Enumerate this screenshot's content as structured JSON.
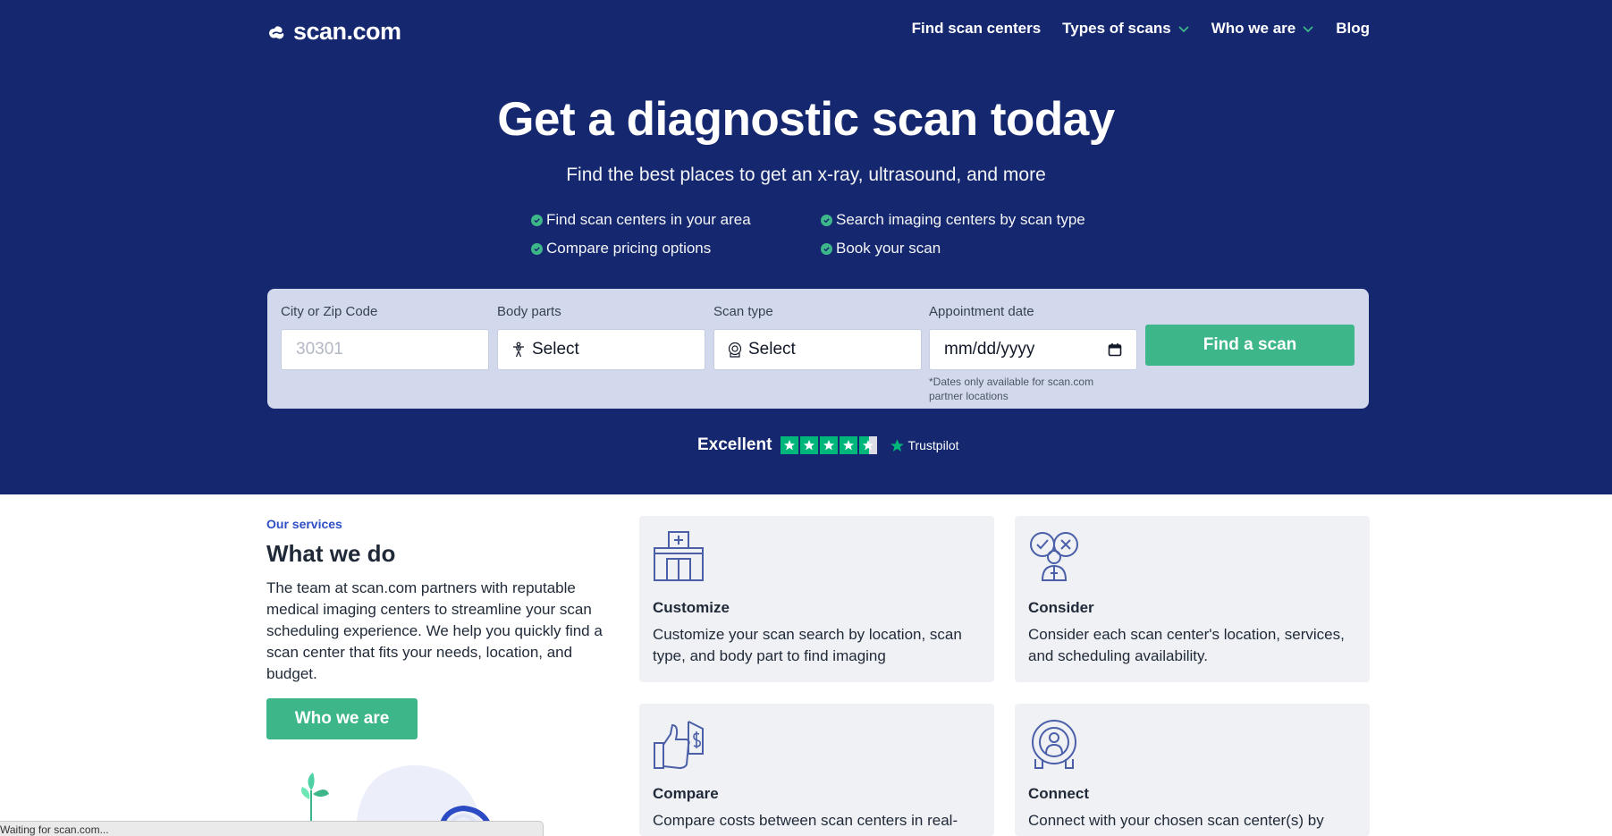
{
  "brand": {
    "logo_text": "scan.com"
  },
  "nav": {
    "links": [
      {
        "label": "Find scan centers",
        "has_dropdown": false
      },
      {
        "label": "Types of scans",
        "has_dropdown": true
      },
      {
        "label": "Who we are",
        "has_dropdown": true
      },
      {
        "label": "Blog",
        "has_dropdown": false
      }
    ]
  },
  "hero": {
    "title": "Get a diagnostic scan today",
    "subtitle": "Find the best places to get an x-ray, ultrasound, and more",
    "features": [
      "Find scan centers in your area",
      "Search imaging centers by scan type",
      "Compare pricing options",
      "Book your scan"
    ]
  },
  "search": {
    "city": {
      "label": "City or Zip Code",
      "placeholder": "30301"
    },
    "body_parts": {
      "label": "Body parts",
      "value": "Select"
    },
    "scan_type": {
      "label": "Scan type",
      "value": "Select"
    },
    "date": {
      "label": "Appointment date",
      "value": "mm/dd/yyyy",
      "note": "*Dates only available for scan.com partner locations"
    },
    "submit_label": "Find a scan"
  },
  "trustpilot": {
    "label": "Excellent",
    "rating_stars": 4.5,
    "brand": "Trustpilot"
  },
  "services": {
    "eyebrow": "Our services",
    "title": "What we do",
    "body": "The team at scan.com partners with reputable medical imaging centers to streamline your scan scheduling experience. We help you quickly find a scan center that fits your needs, location, and budget.",
    "button_label": "Who we are",
    "cards": [
      {
        "title": "Customize",
        "text": "Customize your scan search by location, scan type, and body part to find imaging",
        "icon": "hospital-icon"
      },
      {
        "title": "Consider",
        "text": "Consider each scan center's location, services, and scheduling availability.",
        "icon": "consider-doctor-icon"
      },
      {
        "title": "Compare",
        "text": "Compare costs between scan centers in real-",
        "icon": "compare-price-icon"
      },
      {
        "title": "Connect",
        "text": "Connect with your chosen scan center(s) by",
        "icon": "scanner-machine-icon"
      }
    ]
  },
  "colors": {
    "hero_bg": "#15276f",
    "accent_green": "#3db78a",
    "search_bg": "#d3d9ec",
    "card_bg": "#f0f1f5",
    "eyebrow_blue": "#2e4fc6"
  },
  "browser_status": {
    "text": "Waiting for scan.com..."
  }
}
